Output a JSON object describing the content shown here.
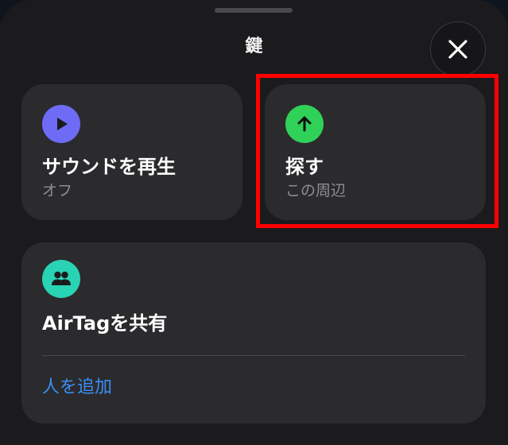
{
  "sheet": {
    "title": "鍵"
  },
  "close_button": {
    "icon": "close-icon"
  },
  "actions": {
    "play_sound": {
      "icon": "play-icon",
      "icon_color": "#6e6cf6",
      "title": "サウンドを再生",
      "status": "オフ"
    },
    "find": {
      "icon": "arrow-up-icon",
      "icon_color": "#30d158",
      "title": "探す",
      "status": "この周辺"
    },
    "share": {
      "icon": "people-icon",
      "icon_color": "#2ad3b4",
      "title": "AirTagを共有",
      "add_person_label": "人を追加",
      "link_color": "#3b8ef3"
    }
  },
  "highlight_color": "#ff0000"
}
